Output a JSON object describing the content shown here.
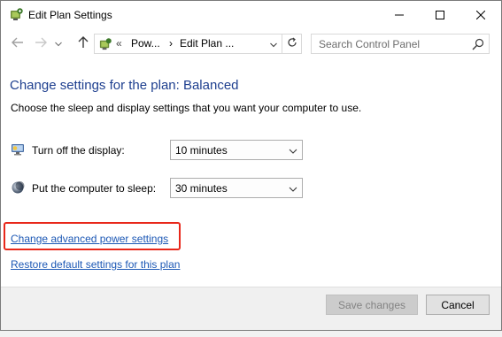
{
  "window": {
    "title": "Edit Plan Settings"
  },
  "navigation": {
    "crumb_separator": "«",
    "breadcrumb": [
      "Pow...",
      "Edit Plan ..."
    ],
    "crumb_arrow": "›",
    "search_placeholder": "Search Control Panel"
  },
  "content": {
    "heading": "Change settings for the plan: Balanced",
    "subheading": "Choose the sleep and display settings that you want your computer to use.",
    "settings": [
      {
        "label": "Turn off the display:",
        "value": "10 minutes",
        "icon": "display-icon"
      },
      {
        "label": "Put the computer to sleep:",
        "value": "30 minutes",
        "icon": "sleep-moon-icon"
      }
    ],
    "links": {
      "advanced": "Change advanced power settings",
      "restore": "Restore default settings for this plan"
    }
  },
  "footer": {
    "save_label": "Save changes",
    "cancel_label": "Cancel"
  },
  "colors": {
    "heading": "#1e3f8f",
    "link": "#1c58b5",
    "highlight": "#e8271a"
  },
  "icons": [
    "power-plan-icon",
    "minimize-icon",
    "maximize-icon",
    "close-icon",
    "back-arrow-icon",
    "forward-arrow-icon",
    "recent-chevron-icon",
    "up-arrow-icon",
    "address-dropdown-icon",
    "refresh-icon",
    "search-icon",
    "chevron-down-icon"
  ],
  "state": {
    "save_disabled": true,
    "highlighted_link": "advanced"
  }
}
